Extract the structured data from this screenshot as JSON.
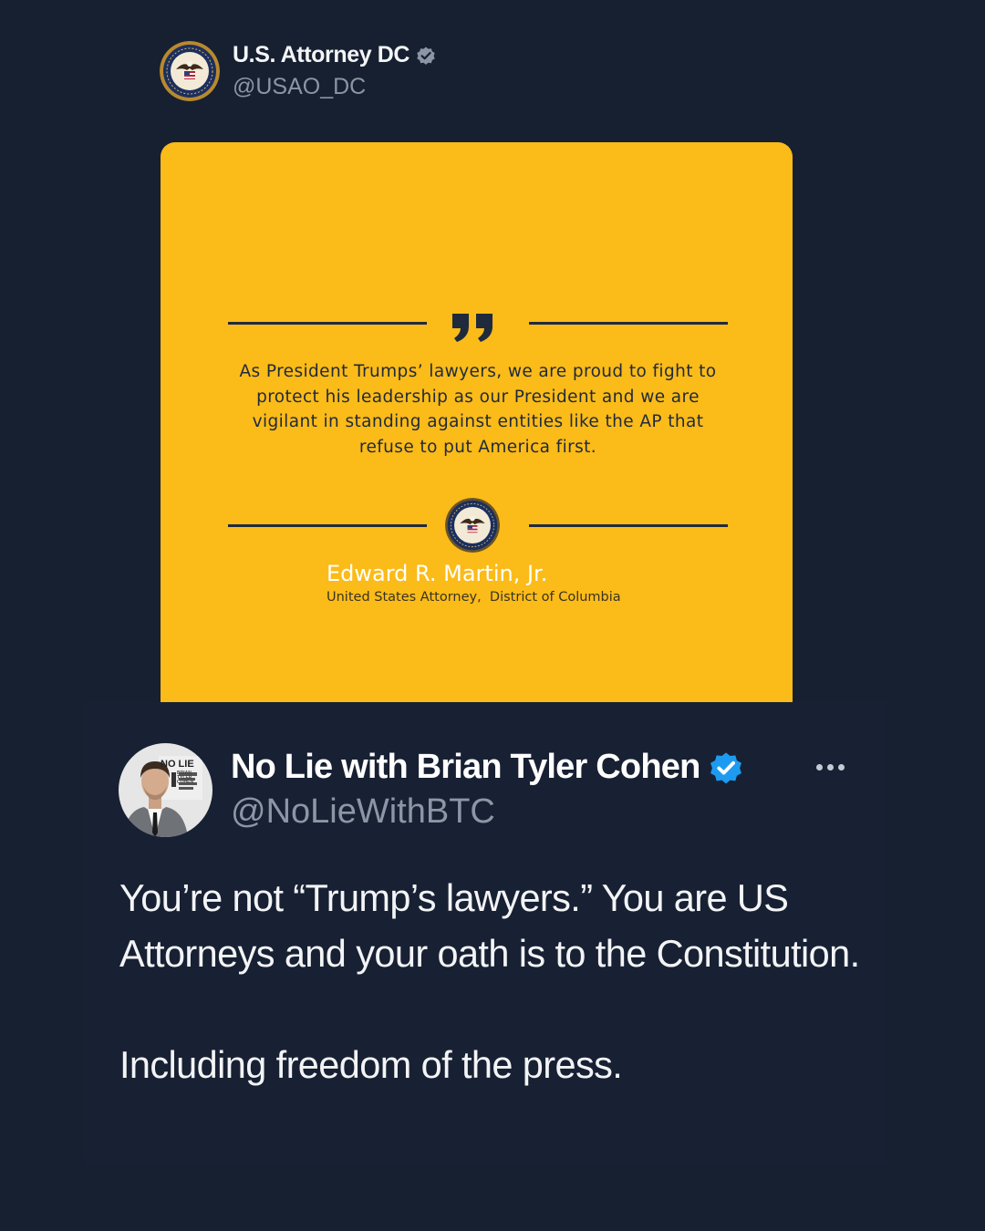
{
  "original_tweet": {
    "display_name": "U.S. Attorney DC",
    "handle": "@USAO_DC",
    "verified": true,
    "badge_color": "#8b95a6",
    "avatar_icon": "department-of-justice-seal-icon",
    "attached_image": {
      "background_color": "#fbbb18",
      "quote_icon": "quote-marks-icon",
      "quote": "As President Trumps’ lawyers, we are proud to fight to protect his leadership as our President and we are vigilant in standing against entities like the AP that refuse to put America first.",
      "seal_icon": "department-of-justice-seal-icon",
      "signer_name": "Edward R. Martin, Jr.",
      "signer_title": "United States Attorney,  District of Columbia"
    }
  },
  "reply_tweet": {
    "display_name": "No Lie with Brian Tyler Cohen",
    "handle": "@NoLieWithBTC",
    "verified": true,
    "badge_color": "#1d9bf0",
    "avatar_icon": "profile-photo",
    "avatar_logo_text": "NO LIE",
    "avatar_logo_subtext": "BRIAN TYLER COHEN",
    "more_icon": "more-options-icon",
    "body_paragraphs": [
      "You’re not “Trump’s lawyers.” You are US Attorneys and your oath is to the Constitution.",
      "Including freedom of the press."
    ]
  }
}
